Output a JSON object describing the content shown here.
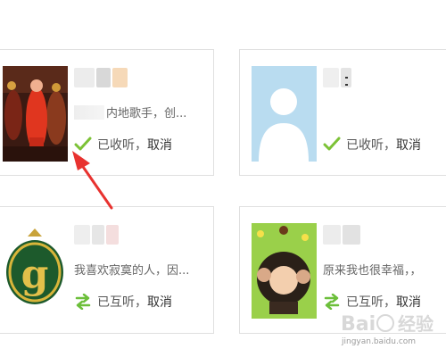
{
  "cards": [
    {
      "desc": "内地歌手，创...",
      "status": "已收听",
      "separator": "，",
      "action": "取消",
      "status_icon": "check-icon"
    },
    {
      "desc": "",
      "status": "已收听",
      "separator": "，",
      "action": "取消",
      "status_icon": "check-icon"
    },
    {
      "desc": "我喜欢寂寞的人，因...",
      "status": "已互听",
      "separator": "，",
      "action": "取消",
      "status_icon": "mutual-arrows-icon"
    },
    {
      "desc": "原来我也很幸福，，",
      "status": "已互听",
      "separator": "，",
      "action": "取消",
      "status_icon": "mutual-arrows-icon"
    }
  ],
  "colors": {
    "check": "#7cc236",
    "mutual": "#6cbf3a",
    "arrow": "#e8322f"
  },
  "watermark": {
    "logo": "Bai 经验",
    "url": "jingyan.baidu.com"
  }
}
